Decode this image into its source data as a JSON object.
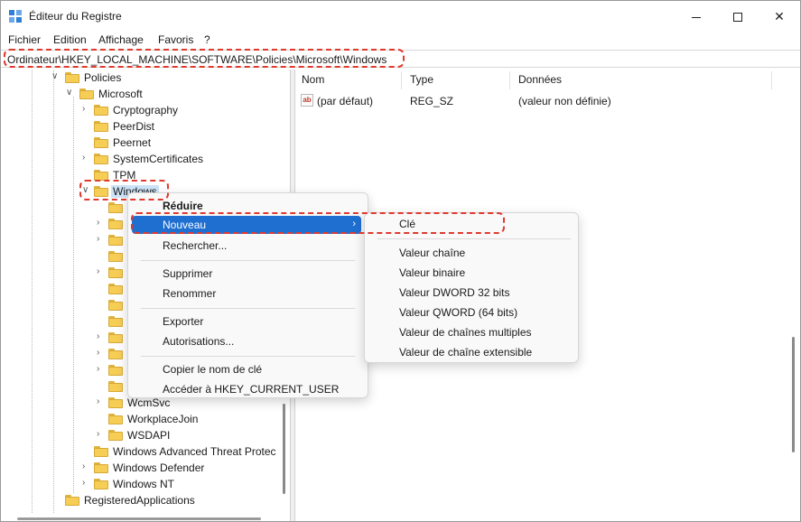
{
  "window": {
    "title": "Éditeur du Registre",
    "controls": {
      "minimize_icon": "minimize-icon",
      "maximize_icon": "maximize-icon",
      "close_glyph": "✕"
    }
  },
  "menubar": [
    "Fichier",
    "Edition",
    "Affichage",
    "Favoris",
    "?"
  ],
  "address": "Ordinateur\\HKEY_LOCAL_MACHINE\\SOFTWARE\\Policies\\Microsoft\\Windows",
  "tree": {
    "policies": "Policies",
    "microsoft": "Microsoft",
    "children": [
      "Cryptography",
      "PeerDist",
      "Peernet",
      "SystemCertificates",
      "TPM"
    ],
    "windows": "Windows",
    "partial": "WcmSvc",
    "after_windows": [
      "WorkplaceJoin",
      "WSDAPI"
    ],
    "siblings": [
      "Windows Advanced Threat Protec",
      "Windows Defender",
      "Windows NT"
    ],
    "registered": "RegisteredApplications"
  },
  "values": {
    "headers": {
      "name": "Nom",
      "type": "Type",
      "data": "Données"
    },
    "rows": [
      {
        "name": "(par défaut)",
        "type": "REG_SZ",
        "data": "(valeur non définie)",
        "icon": "ab"
      }
    ]
  },
  "context_menu": {
    "items": {
      "collapse": "Réduire",
      "new": "Nouveau",
      "find": "Rechercher...",
      "delete": "Supprimer",
      "rename": "Renommer",
      "export": "Exporter",
      "permissions": "Autorisations...",
      "copy_key": "Copier le nom de clé",
      "goto_hkcu": "Accéder à HKEY_CURRENT_USER"
    },
    "submenu_arrow": "›"
  },
  "submenu": {
    "key": "Clé",
    "string": "Valeur chaîne",
    "binary": "Valeur binaire",
    "dword": "Valeur DWORD 32 bits",
    "qword": "Valeur QWORD (64 bits)",
    "multi": "Valeur de chaînes multiples",
    "expand": "Valeur de chaîne extensible"
  },
  "colors": {
    "highlight": "#1f6fd1",
    "annotation": "#e03a2f",
    "folder": "#f6cd55"
  }
}
